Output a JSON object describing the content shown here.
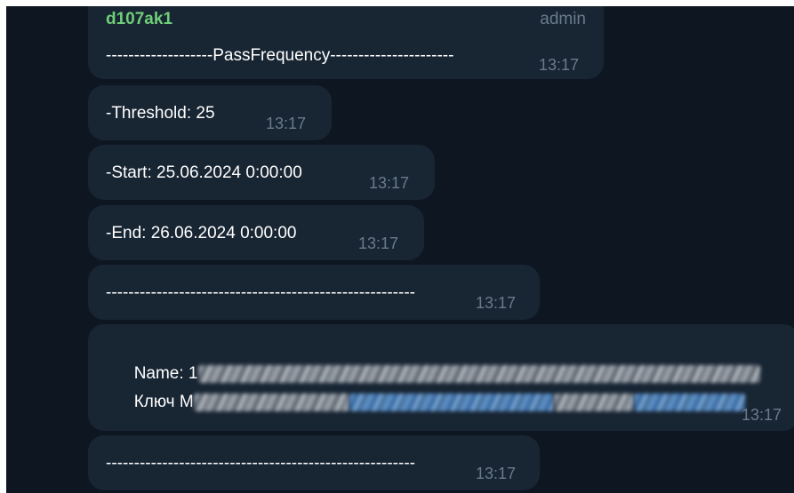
{
  "messages": [
    {
      "sender": "d107ak1",
      "role": "admin",
      "text": "-------------------PassFrequency----------------------",
      "time": "13:17"
    },
    {
      "text": "-Threshold: 25",
      "time": "13:17"
    },
    {
      "text": "-Start: 25.06.2024 0:00:00",
      "time": "13:17"
    },
    {
      "text": "-End: 26.06.2024 0:00:00",
      "time": "13:17"
    },
    {
      "text": "-------------------------------------------------------",
      "time": "13:17"
    },
    {
      "line1_label": "Name: 1",
      "line2_label": "Ключ M",
      "time": "13:17"
    },
    {
      "text": "-------------------------------------------------------",
      "time": "13:17"
    }
  ]
}
